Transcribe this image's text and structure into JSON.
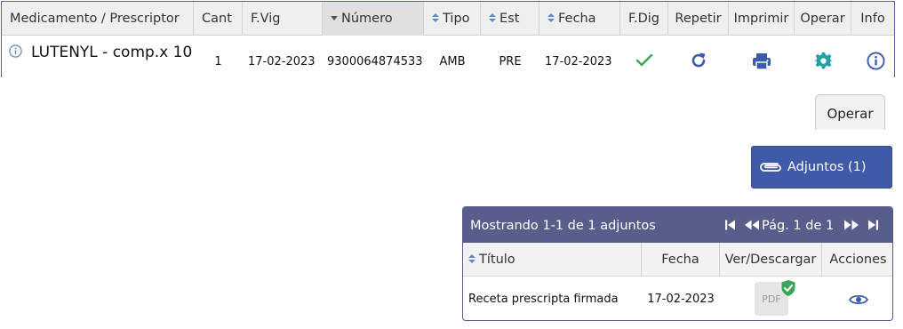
{
  "table": {
    "columns": {
      "medicamento": "Medicamento / Prescriptor",
      "cant": "Cant",
      "fvig": "F.Vig",
      "numero": "Número",
      "tipo": "Tipo",
      "est": "Est",
      "fecha": "Fecha",
      "fdig": "F.Dig",
      "repetir": "Repetir",
      "imprimir": "Imprimir",
      "operar": "Operar",
      "info": "Info"
    },
    "row": {
      "medicamento": "LUTENYL - comp.x 10",
      "cant": "1",
      "fvig": "17-02-2023",
      "numero": "9300064874533",
      "tipo": "AMB",
      "est": "PRE",
      "fecha": "17-02-2023"
    },
    "sorted_column": "numero",
    "sort_direction": "descending"
  },
  "tab": {
    "label": "Operar"
  },
  "adjuntos_button": {
    "label": "Adjuntos (1)",
    "icon": "paperclip-icon"
  },
  "attachments": {
    "showing": "Mostrando 1-1 de 1 adjuntos",
    "page_label": "Pág. 1 de 1",
    "columns": {
      "titulo": "Título",
      "fecha": "Fecha",
      "ver": "Ver/Descargar",
      "acciones": "Acciones"
    },
    "rows": [
      {
        "titulo": "Receta prescripta firmada",
        "fecha": "17-02-2023",
        "file_label": "PDF"
      }
    ]
  },
  "colors": {
    "header_bg": "#585d8b",
    "button_bg": "#3f5aa8",
    "check_green": "#3aa655",
    "icon_blue": "#3d5ba9",
    "gear_teal": "#22a2a4"
  }
}
